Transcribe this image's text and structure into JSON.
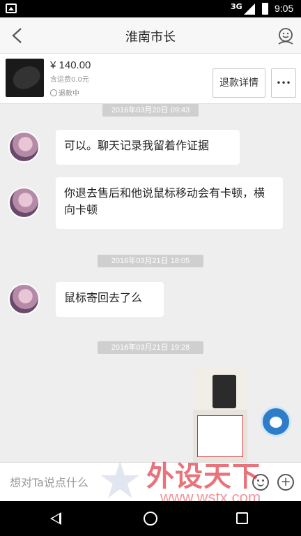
{
  "status_bar": {
    "network": "3G",
    "time": "9:05"
  },
  "header": {
    "title": "淮南市长"
  },
  "product": {
    "price": "¥ 140.00",
    "shipping": "含运费0.0元",
    "status": "退款中",
    "refund_button": "退款详情",
    "more_button": "•••"
  },
  "chat": {
    "timestamps": [
      "2016年03月20日 09:43",
      "2016年03月21日 18:05",
      "2016年03月21日 19:28"
    ],
    "messages": [
      {
        "text": "可以。聊天记录我留着作证据"
      },
      {
        "text": "你退去售后和他说鼠标移动会有卡顿，横向卡顿"
      },
      {
        "text": "鼠标寄回去了么"
      }
    ]
  },
  "input": {
    "placeholder": "想对Ta说点什么"
  },
  "watermark": {
    "brand": "外设天下",
    "url": "www.wstx.com"
  },
  "icons": {
    "back": "chevron-left-icon",
    "profile": "user-icon",
    "emoji": "smiley-icon",
    "add": "plus-icon"
  }
}
